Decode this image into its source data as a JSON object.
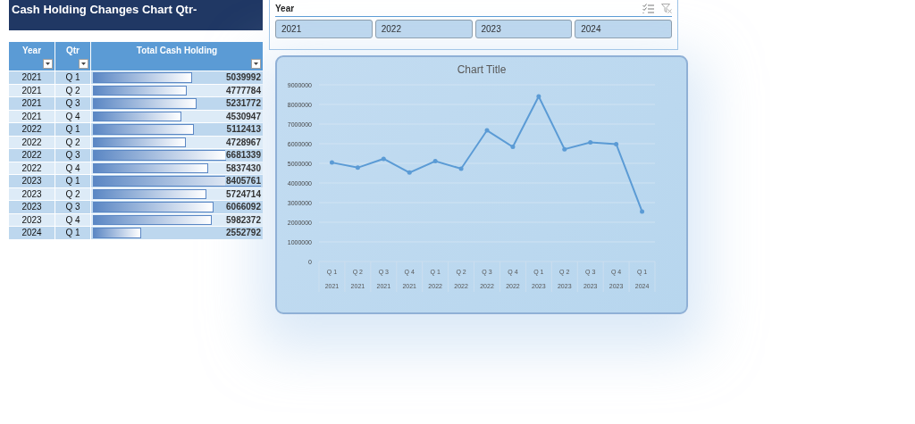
{
  "title": "Cash Holding Changes Chart Qtr-",
  "table": {
    "columns": [
      "Year",
      "Qtr",
      "Total Cash Holding"
    ],
    "rows": [
      {
        "year": "2021",
        "qtr": "Q 1",
        "total": "5039992",
        "level": 0.5996
      },
      {
        "year": "2021",
        "qtr": "Q 2",
        "total": "4777784",
        "level": 0.5684
      },
      {
        "year": "2021",
        "qtr": "Q 3",
        "total": "5231772",
        "level": 0.6224
      },
      {
        "year": "2021",
        "qtr": "Q 4",
        "total": "4530947",
        "level": 0.539
      },
      {
        "year": "2022",
        "qtr": "Q 1",
        "total": "5112413",
        "level": 0.6082
      },
      {
        "year": "2022",
        "qtr": "Q 2",
        "total": "4728967",
        "level": 0.5626
      },
      {
        "year": "2022",
        "qtr": "Q 3",
        "total": "6681339",
        "level": 0.7949
      },
      {
        "year": "2022",
        "qtr": "Q 4",
        "total": "5837430",
        "level": 0.6945
      },
      {
        "year": "2023",
        "qtr": "Q 1",
        "total": "8405761",
        "level": 1
      },
      {
        "year": "2023",
        "qtr": "Q 2",
        "total": "5724714",
        "level": 0.681
      },
      {
        "year": "2023",
        "qtr": "Q 3",
        "total": "6066092",
        "level": 0.7217
      },
      {
        "year": "2023",
        "qtr": "Q 4",
        "total": "5982372",
        "level": 0.7117
      },
      {
        "year": "2024",
        "qtr": "Q 1",
        "total": "2552792",
        "level": 0.3037
      }
    ]
  },
  "slicer": {
    "title": "Year",
    "items": [
      {
        "label": "2021",
        "selected": true
      },
      {
        "label": "2022",
        "selected": true
      },
      {
        "label": "2023",
        "selected": true
      },
      {
        "label": "2024",
        "selected": true
      }
    ]
  },
  "chart": {
    "chart_data": {
      "type": "line",
      "title": "Chart Title",
      "categories": [
        "Q 1",
        "Q 2",
        "Q 3",
        "Q 4",
        "Q 1",
        "Q 2",
        "Q 3",
        "Q 4",
        "Q 1",
        "Q 2",
        "Q 3",
        "Q 4",
        "Q 1"
      ],
      "ylim": [
        0,
        9000000
      ],
      "yticks": [
        {
          "value": 0,
          "label": "0"
        },
        {
          "value": 1000000,
          "label": "1000000"
        },
        {
          "value": 2000000,
          "label": "2000000"
        },
        {
          "value": 3000000,
          "label": "3000000"
        },
        {
          "value": 4000000,
          "label": "4000000"
        },
        {
          "value": 5000000,
          "label": "5000000"
        },
        {
          "value": 6000000,
          "label": "6000000"
        },
        {
          "value": 7000000,
          "label": "7000000"
        },
        {
          "value": 8000000,
          "label": "8000000"
        },
        {
          "value": 9000000,
          "label": "9000000"
        }
      ],
      "grid": true,
      "series": [
        {
          "color": "#5b9bd5",
          "values": [
            5040000,
            4780000,
            5230000,
            4530000,
            5110000,
            4730000,
            6680000,
            5840000,
            8410000,
            5720000,
            6070000,
            5980000,
            2550000
          ]
        }
      ]
    },
    "category_years": [
      "2021",
      "2021",
      "2021",
      "2021",
      "2022",
      "2022",
      "2022",
      "2022",
      "2023",
      "2023",
      "2023",
      "2023",
      "2024"
    ]
  }
}
